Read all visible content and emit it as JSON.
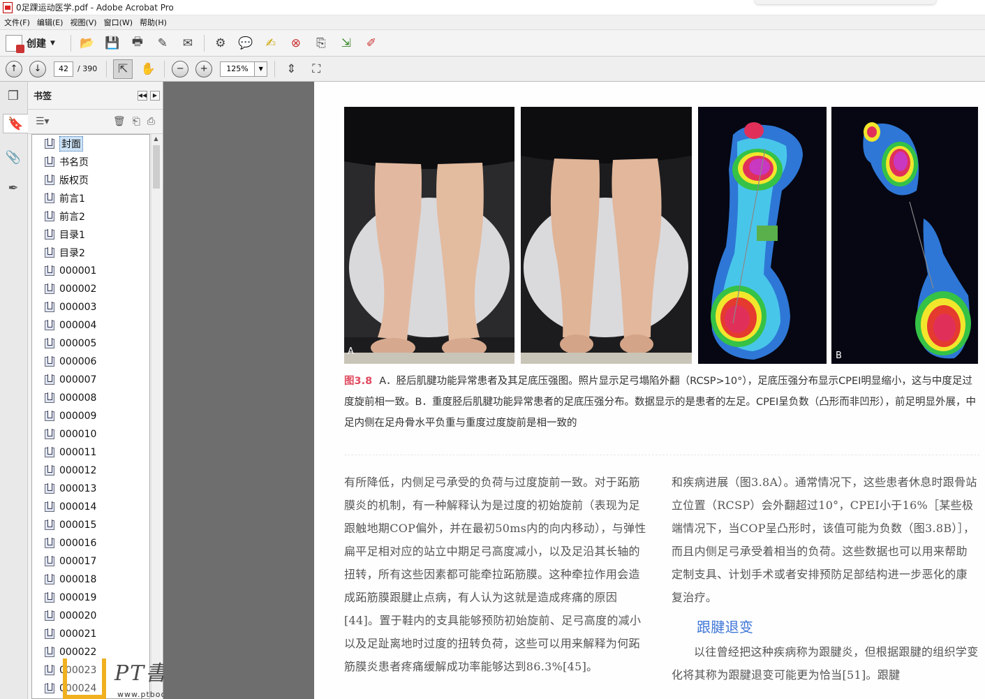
{
  "window": {
    "title": "0足踝运动医学.pdf - Adobe Acrobat Pro"
  },
  "menu": [
    "文件(F)",
    "编辑(E)",
    "视图(V)",
    "窗口(W)",
    "帮助(H)"
  ],
  "toolbar": {
    "create_label": "创建"
  },
  "nav": {
    "page_current": "42",
    "page_total": "/ 390",
    "zoom": "125%"
  },
  "panel": {
    "title": "书签",
    "bookmarks": [
      "封面",
      "书名页",
      "版权页",
      "前言1",
      "前言2",
      "目录1",
      "目录2",
      "000001",
      "000002",
      "000003",
      "000004",
      "000005",
      "000006",
      "000007",
      "000008",
      "000009",
      "000010",
      "000011",
      "000012",
      "000013",
      "000014",
      "000015",
      "000016",
      "000017",
      "000018",
      "000019",
      "000020",
      "000021",
      "000022",
      "000023",
      "000024"
    ],
    "selected_index": 0
  },
  "watermark": {
    "text": "PT書屋",
    "url": "www.ptbook.cn"
  },
  "figure": {
    "label_a": "A",
    "label_b": "B",
    "caption_label": "图3.8",
    "caption_text": "A．胫后肌腱功能异常患者及其足底压强图。照片显示足弓塌陷外翻（RCSP>10°），足底压强分布显示CPEI明显缩小，这与中度足过度旋前相一致。B．重度胫后肌腱功能异常患者的足底压强分布。数据显示的是患者的左足。CPEI呈负数（凸形而非凹形），前足明显外展，中足内侧在足舟骨水平负重与重度过度旋前是相一致的"
  },
  "body": {
    "col1": "有所降低，内侧足弓承受的负荷与过度旋前一致。对于跖筋膜炎的机制，有一种解释认为是过度的初始旋前（表现为足跟触地期COP偏外，并在最初50ms内的向内移动），与弹性扁平足相对应的站立中期足弓高度减小，以及足沿其长轴的扭转，所有这些因素都可能牵拉跖筋膜。这种牵拉作用会造成跖筋膜跟腱止点病，有人认为这就是造成疼痛的原因[44]。置于鞋内的支具能够预防初始旋前、足弓高度的减小以及足趾离地时过度的扭转负荷，这些可以用来解释为何跖筋膜炎患者疼痛缓解成功率能够达到86.3%[45]。",
    "col2_p1": "和疾病进展（图3.8A）。通常情况下，这些患者休息时跟骨站立位置（RCSP）会外翻超过10°，CPEI小于16%［某些极端情况下，当COP呈凸形时，该值可能为负数（图3.8B）］，而且内侧足弓承受着相当的负荷。这些数据也可以用来帮助定制支具、计划手术或者安排预防足部结构进一步恶化的康复治疗。",
    "col2_heading": "跟腱退变",
    "col2_p2": "以往曾经把这种疾病称为跟腱炎，但根据跟腱的组织学变化将其称为跟腱退变可能更为恰当[51]。跟腱"
  },
  "colors": {
    "caption_label": "#e14a5f",
    "heading": "#3f76d8",
    "viewer_bg": "#6e6e6e"
  }
}
